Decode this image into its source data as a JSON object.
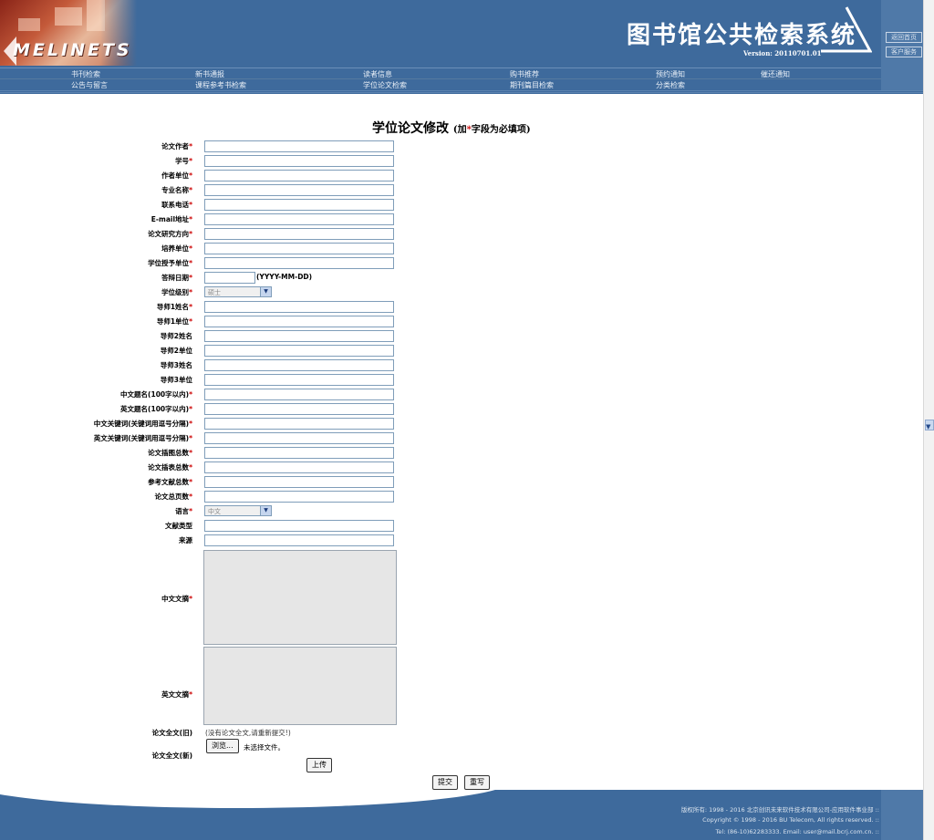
{
  "header": {
    "logo": "MELINETS",
    "system_title": "图书馆公共检索系统",
    "version": "Version: 20110701.01",
    "side_links": [
      "返回首页",
      "客户服务"
    ]
  },
  "nav": {
    "row1": [
      "书刊检索",
      "新书通报",
      "读者信息",
      "购书推荐",
      "预约通知",
      "催还通知"
    ],
    "row2": [
      "公告与留言",
      "课程参考书检索",
      "学位论文检索",
      "期刊篇目检索",
      "分类检索"
    ]
  },
  "form": {
    "title": "学位论文修改",
    "hint_prefix": "(加",
    "hint_star": "*",
    "hint_suffix": "字段为必填项)",
    "fields": [
      {
        "label": "论文作者",
        "required": "*"
      },
      {
        "label": "学号",
        "required": "*"
      },
      {
        "label": "作者单位",
        "required": "*"
      },
      {
        "label": "专业名称",
        "required": "*"
      },
      {
        "label": "联系电话",
        "required": "*"
      },
      {
        "label": "E-mail地址",
        "required": "*"
      },
      {
        "label": "论文研究方向",
        "required": "*"
      },
      {
        "label": "培养单位",
        "required": "*"
      },
      {
        "label": "学位授予单位",
        "required": "*"
      },
      {
        "label": "答辩日期",
        "required": "*",
        "hint": "(YYYY-MM-DD)"
      },
      {
        "label": "学位级别",
        "required": "*",
        "select": "硕士"
      },
      {
        "label": "导师1姓名",
        "required": "*"
      },
      {
        "label": "导师1单位",
        "required": "*"
      },
      {
        "label": "导师2姓名",
        "required": ""
      },
      {
        "label": "导师2单位",
        "required": ""
      },
      {
        "label": "导师3姓名",
        "required": ""
      },
      {
        "label": "导师3单位",
        "required": ""
      },
      {
        "label": "中文题名(100字以内)",
        "required": "*"
      },
      {
        "label": "英文题名(100字以内)",
        "required": "*"
      },
      {
        "label": "中文关键词(关键词用逗号分隔)",
        "required": "*"
      },
      {
        "label": "英文关键词(关键词用逗号分隔)",
        "required": "*"
      },
      {
        "label": "论文插图总数",
        "required": "*"
      },
      {
        "label": "论文插表总数",
        "required": "*"
      },
      {
        "label": "参考文献总数",
        "required": "*"
      },
      {
        "label": "论文总页数",
        "required": "*"
      },
      {
        "label": "语言",
        "required": "*",
        "select": "中文"
      },
      {
        "label": "文献类型",
        "required": ""
      },
      {
        "label": "来源",
        "required": ""
      }
    ],
    "abstract_cn_label": "中文文摘",
    "abstract_en_label": "英文文摘",
    "fulltext_old_label": "论文全文(旧)",
    "fulltext_old_note": "(没有论文全文,请重新提交!)",
    "fulltext_new_label": "论文全文(新)",
    "browse_label": "浏览...",
    "no_file_label": "未选择文件。",
    "upload_label": "上传",
    "submit_label": "提交",
    "reset_label": "重写"
  },
  "footer": {
    "line1": "版权所有: 1998 - 2016 北京创讯未来软件技术有限公司-应用软件事业部 ::",
    "line2": "Copyright © 1998 - 2016 BU Telecom, All rights reserved. ::",
    "line3": "Tel: (86-10)62283333.   Email: user@mail.bcrj.com.cn. ::"
  }
}
